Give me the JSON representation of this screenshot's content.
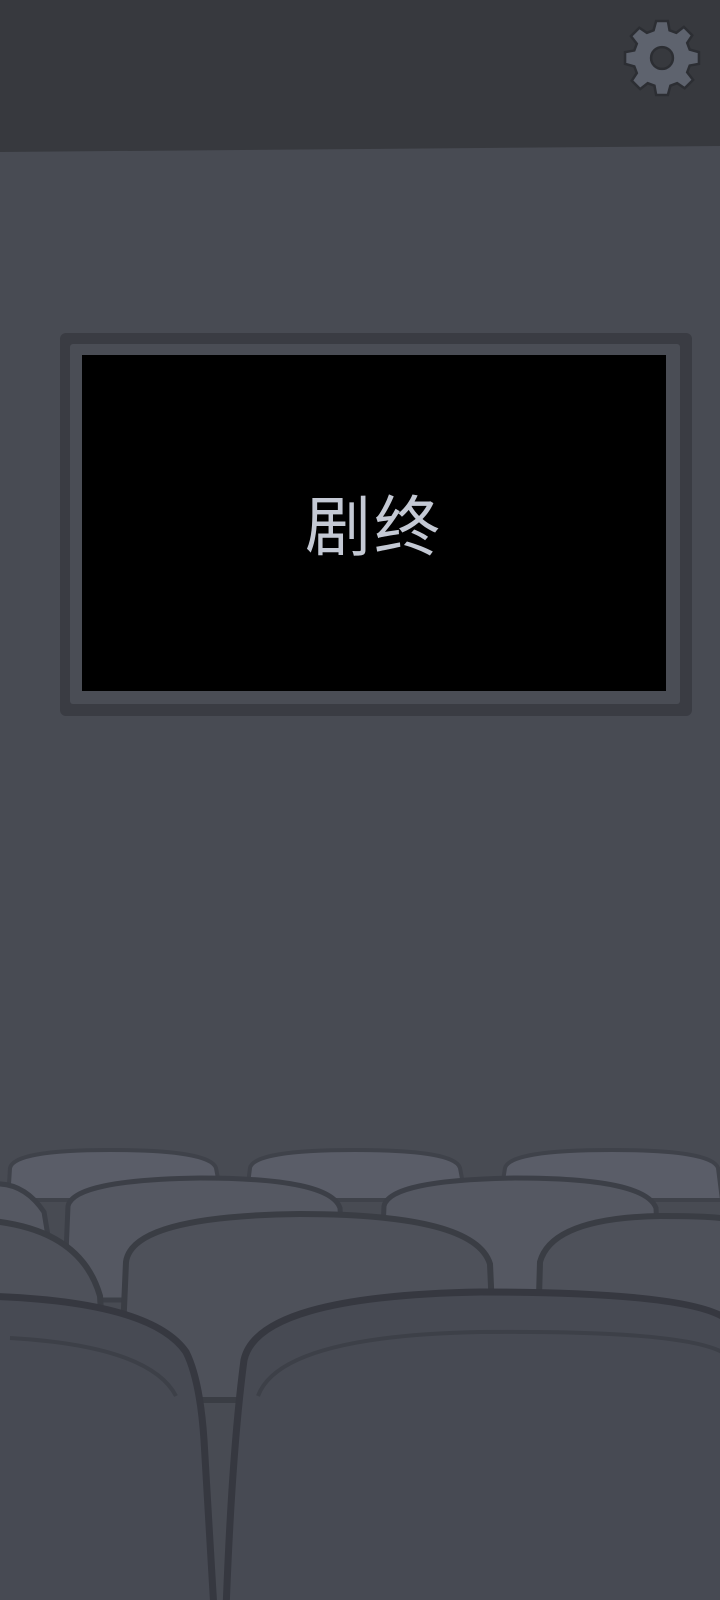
{
  "header": {
    "settings_icon": "gear-icon"
  },
  "screen": {
    "text": "剧终"
  },
  "colors": {
    "top_bar": "#37393e",
    "wall": "#484b53",
    "screen_frame": "#3a3c43",
    "screen": "#000000",
    "screen_text": "#c4c9d4",
    "seat": "#50535c",
    "gear": "#5e636e"
  }
}
